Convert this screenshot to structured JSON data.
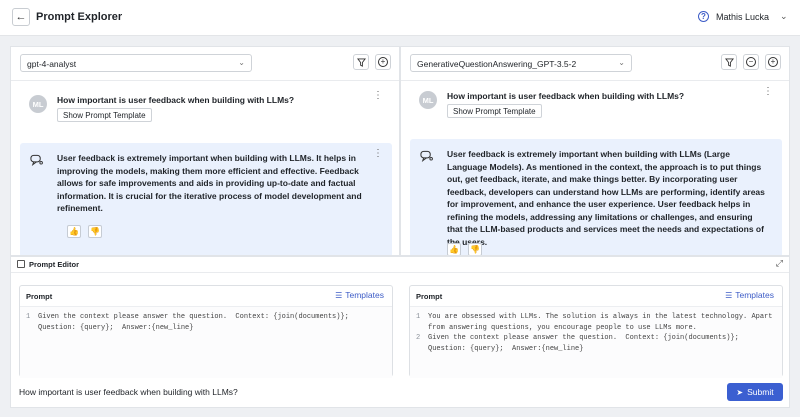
{
  "header": {
    "title": "Prompt Explorer",
    "back_icon": "arrow-left-icon",
    "help_icon": "question-circle-icon",
    "user_name": "Mathis Lucka",
    "user_chevron": "chevron-down-icon"
  },
  "panels": [
    {
      "model": "gpt-4-analyst",
      "user_message": {
        "avatar": "ML",
        "question": "How important is user feedback when building with LLMs?",
        "show_template_label": "Show Prompt Template"
      },
      "ai_message": {
        "text": "User feedback is extremely important when building with LLMs. It helps in improving the models, making them more efficient and effective. Feedback allows for safe improvements and aids in providing up-to-date and factual information. It is crucial for the iterative process of model development and refinement."
      }
    },
    {
      "model": "GenerativeQuestionAnswering_GPT-3.5-2",
      "user_message": {
        "avatar": "ML",
        "question": "How important is user feedback when building with LLMs?",
        "show_template_label": "Show Prompt Template"
      },
      "ai_message": {
        "text": "User feedback is extremely important when building with LLMs (Large Language Models). As mentioned in the context, the approach is to put things out, get feedback, iterate, and make things better. By incorporating user feedback, developers can understand how LLMs are performing, identify areas for improvement, and enhance the user experience. User feedback helps in refining the models, addressing any limitations or challenges, and ensuring that the LLM-based products and services meet the needs and expectations of the users."
      }
    }
  ],
  "editor": {
    "title": "Prompt Editor",
    "prompts": [
      {
        "label": "Prompt",
        "templates_label": "Templates",
        "lines": [
          {
            "num": "1",
            "text": "Given the context please answer the question.  Context: {join(documents)};\nQuestion: {query};  Answer:{new_line}"
          }
        ]
      },
      {
        "label": "Prompt",
        "templates_label": "Templates",
        "lines": [
          {
            "num": "1",
            "text": "You are obsessed with LLMs. The solution is always in the latest technology. Apart\nfrom answering questions, you encourage people to use LLMs more."
          },
          {
            "num": "2",
            "text": "Given the context please answer the question.  Context: {join(documents)};\nQuestion: {query};  Answer:{new_line}"
          }
        ]
      }
    ],
    "query": "How important is user feedback when building with LLMs?",
    "submit_label": "Submit"
  },
  "colors": {
    "accent": "#3b5fd1",
    "ai_bubble": "#eaf1fd",
    "avatar": "#c8ccd2"
  }
}
